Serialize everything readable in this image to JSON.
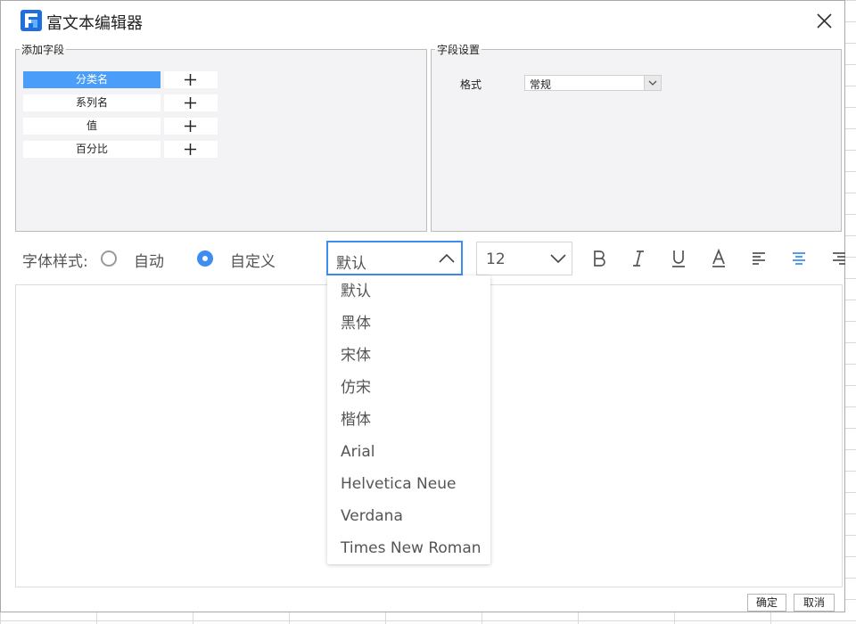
{
  "window": {
    "title": "富文本编辑器",
    "accent": "#3f8cf3",
    "selected_color": "#4a9df8"
  },
  "add_fields": {
    "legend": "添加字段",
    "items": [
      {
        "label": "分类名",
        "selected": true
      },
      {
        "label": "系列名",
        "selected": false
      },
      {
        "label": "值",
        "selected": false
      },
      {
        "label": "百分比",
        "selected": false
      }
    ]
  },
  "field_settings": {
    "legend": "字段设置",
    "format_label": "格式",
    "format_value": "常规"
  },
  "toolbar": {
    "font_style_label": "字体样式:",
    "radio_auto": {
      "label": "自动",
      "checked": false
    },
    "radio_custom": {
      "label": "自定义",
      "checked": true
    },
    "font_family": "默认",
    "font_size": "12",
    "buttons": [
      "bold-icon",
      "italic-icon",
      "underline-icon",
      "font-color-icon",
      "align-left-icon",
      "align-center-icon",
      "align-right-icon"
    ],
    "active_align": "align-center-icon"
  },
  "font_dropdown": {
    "options": [
      "默认",
      "黑体",
      "宋体",
      "仿宋",
      "楷体",
      "Arial",
      "Helvetica Neue",
      "Verdana",
      "Times New Roman"
    ]
  },
  "footer": {
    "ok_label": "确定",
    "cancel_label": "取消"
  }
}
